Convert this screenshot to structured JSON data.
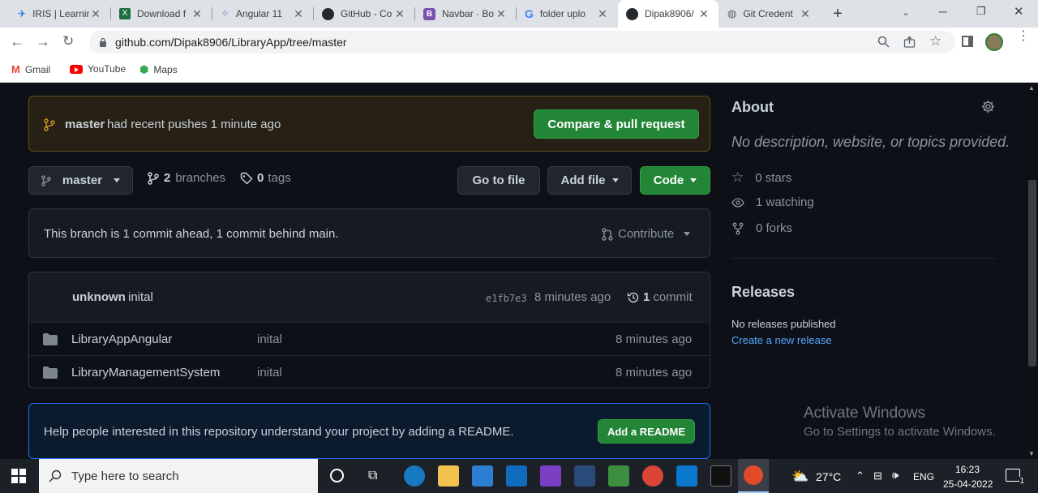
{
  "browser": {
    "tabs": [
      {
        "title": "IRIS | Learning",
        "active": false
      },
      {
        "title": "Download f",
        "active": false
      },
      {
        "title": "Angular 11",
        "active": false
      },
      {
        "title": "GitHub - Co",
        "active": false
      },
      {
        "title": "Navbar · Bo",
        "active": false
      },
      {
        "title": "folder uplo",
        "active": false
      },
      {
        "title": "Dipak8906/",
        "active": true
      },
      {
        "title": "Git Credent",
        "active": false
      }
    ],
    "url": "github.com/Dipak8906/LibraryApp/tree/master",
    "bookmarks": [
      "Gmail",
      "YouTube",
      "Maps"
    ]
  },
  "repo": {
    "push_banner": {
      "branch": "master",
      "text": "had recent pushes 1 minute ago",
      "button": "Compare & pull request"
    },
    "branch_select": "master",
    "branches_count": "2",
    "branches_label": "branches",
    "tags_count": "0",
    "tags_label": "tags",
    "go_to_file": "Go to file",
    "add_file": "Add file",
    "code": "Code",
    "branch_status": "This branch is 1 commit ahead, 1 commit behind main.",
    "contribute": "Contribute",
    "latest_commit": {
      "author": "unknown",
      "message": "inital",
      "sha": "e1fb7e3",
      "time": "8 minutes ago",
      "commits_count": "1",
      "commits_label": "commit"
    },
    "files": [
      {
        "name": "LibraryAppAngular",
        "message": "inital",
        "time": "8 minutes ago"
      },
      {
        "name": "LibraryManagementSystem",
        "message": "inital",
        "time": "8 minutes ago"
      }
    ],
    "readme_prompt": "Help people interested in this repository understand your project by adding a README.",
    "readme_button": "Add a README"
  },
  "about": {
    "title": "About",
    "description": "No description, website, or topics provided.",
    "stars": "0 stars",
    "watching": "1 watching",
    "forks": "0 forks",
    "releases_title": "Releases",
    "no_releases": "No releases published",
    "create_release": "Create a new release"
  },
  "watermark": {
    "line1": "Activate Windows",
    "line2": "Go to Settings to activate Windows."
  },
  "taskbar": {
    "search_placeholder": "Type here to search",
    "temperature": "27°C",
    "language": "ENG",
    "time": "16:23",
    "date": "25-04-2022",
    "notification_count": "1"
  },
  "colors": {
    "green": "#238636",
    "link": "#58a6ff",
    "banner_bg": "#272115",
    "banner_border": "#5e4a1b"
  }
}
